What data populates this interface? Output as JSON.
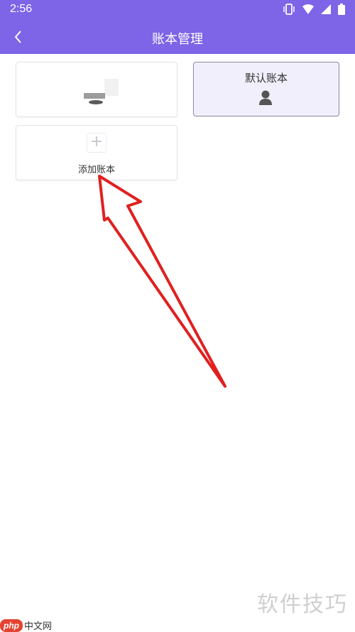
{
  "status_bar": {
    "time": "2:56"
  },
  "app_bar": {
    "title": "账本管理"
  },
  "cards": {
    "default_account_label": "默认账本",
    "add_account_label": "添加账本"
  },
  "watermark": {
    "text": "软件技巧"
  },
  "logo": {
    "mark": "php",
    "text": "中文网"
  },
  "colors": {
    "accent": "#7e64e6",
    "annotation_arrow": "#e02020"
  }
}
